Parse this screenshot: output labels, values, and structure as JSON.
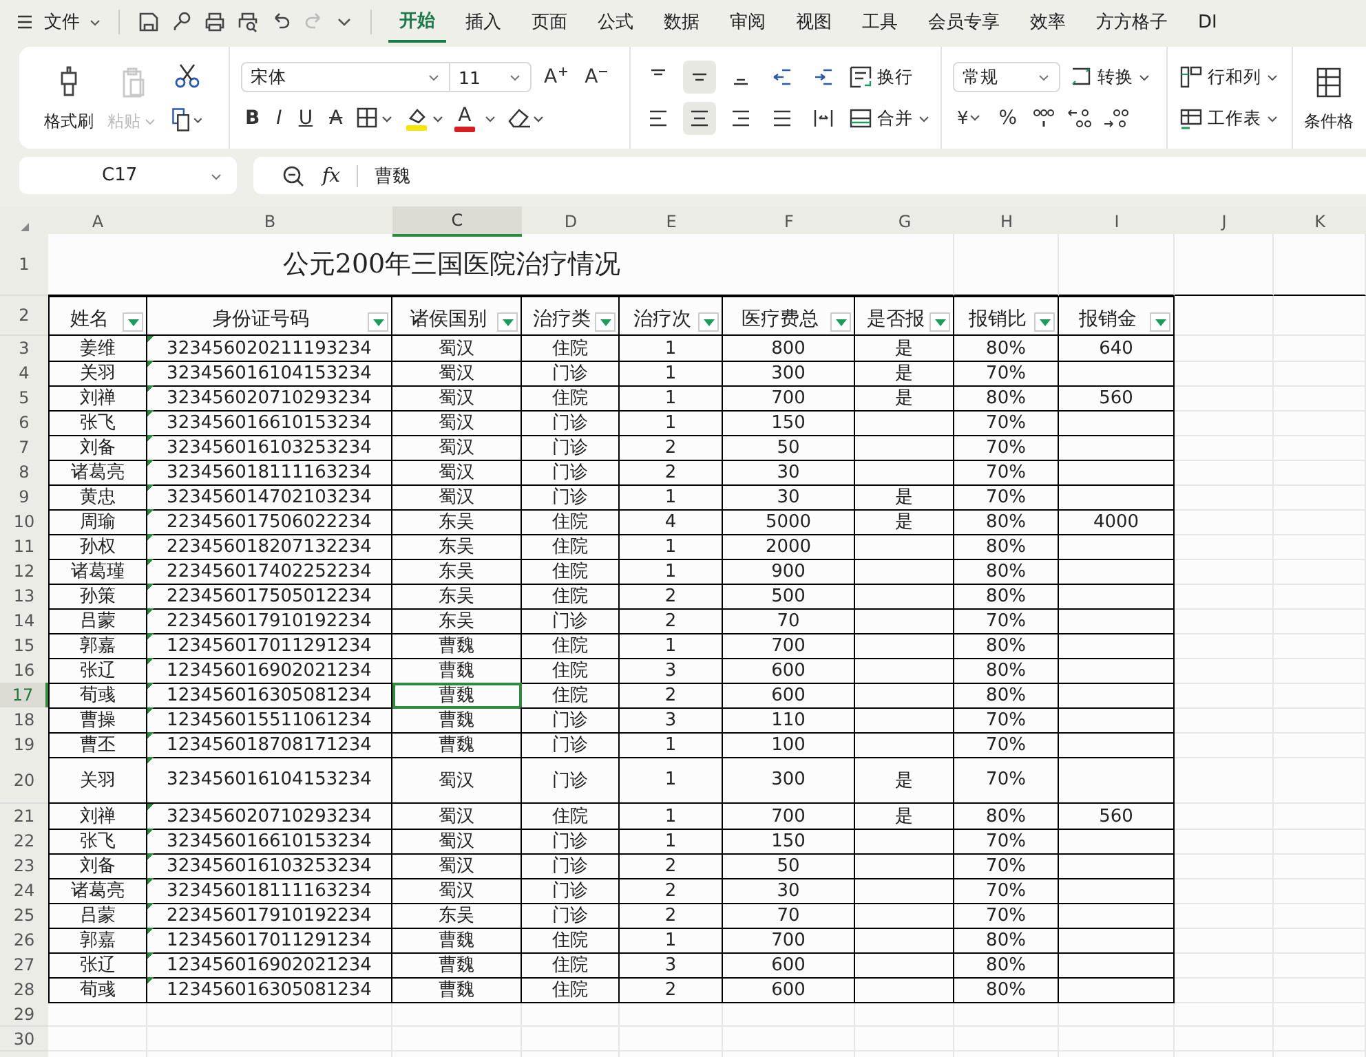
{
  "menu_bar": {
    "file_label": "文件",
    "tabs": [
      {
        "label": "开始",
        "selected": true
      },
      {
        "label": "插入",
        "selected": false
      },
      {
        "label": "页面",
        "selected": false
      },
      {
        "label": "公式",
        "selected": false
      },
      {
        "label": "数据",
        "selected": false
      },
      {
        "label": "审阅",
        "selected": false
      },
      {
        "label": "视图",
        "selected": false
      },
      {
        "label": "工具",
        "selected": false
      },
      {
        "label": "会员专享",
        "selected": false
      },
      {
        "label": "效率",
        "selected": false
      },
      {
        "label": "方方格子",
        "selected": false
      },
      {
        "label": "DI",
        "selected": false
      }
    ]
  },
  "ribbon": {
    "format_painter": "格式刷",
    "paste": {
      "label": "粘贴",
      "disabled": true
    },
    "font": {
      "family": "宋体",
      "size": "11",
      "grow": "A",
      "shrink": "A",
      "styles": [
        {
          "label": "B",
          "kind": "bold"
        },
        {
          "label": "I",
          "kind": "italic"
        },
        {
          "label": "U",
          "kind": "underline"
        },
        {
          "label": "A",
          "kind": "strike"
        }
      ],
      "font_color": "A"
    },
    "alignment": {
      "row_1": [
        {
          "kind": "top",
          "selected": false
        },
        {
          "kind": "middle",
          "selected": true
        },
        {
          "kind": "bottom",
          "selected": false
        },
        {
          "kind": "outdent",
          "selected": false
        },
        {
          "kind": "indent",
          "selected": false
        }
      ],
      "wrap": "换行",
      "row_2": [
        {
          "kind": "left",
          "selected": false
        },
        {
          "kind": "center",
          "selected": true
        },
        {
          "kind": "right",
          "selected": false
        },
        {
          "kind": "justify",
          "selected": false
        },
        {
          "kind": "distributed",
          "selected": false
        }
      ],
      "merge": "合并"
    },
    "number": {
      "format": "常规",
      "convert": "转换",
      "currency": "¥",
      "percent": "%"
    },
    "cells": {
      "rows_cols": "行和列",
      "worksheet": "工作表"
    },
    "conditional": "条件格"
  },
  "formula_bar": {
    "name_box": "C17",
    "fx": "fx",
    "value": "曹魏"
  },
  "sheet": {
    "columns": [
      {
        "letter": "A",
        "selected": false
      },
      {
        "letter": "B",
        "selected": false
      },
      {
        "letter": "C",
        "selected": true
      },
      {
        "letter": "D",
        "selected": false
      },
      {
        "letter": "E",
        "selected": false
      },
      {
        "letter": "F",
        "selected": false
      },
      {
        "letter": "G",
        "selected": false
      },
      {
        "letter": "H",
        "selected": false
      },
      {
        "letter": "I",
        "selected": false
      },
      {
        "letter": "J",
        "selected": false
      },
      {
        "letter": "K",
        "selected": false
      }
    ],
    "title_row": "1",
    "title": "公元200年三国医院治疗情况",
    "header_row": "2",
    "headers": [
      "姓名",
      "身份证号码",
      "诸侯国别",
      "治疗类",
      "治疗次",
      "医疗费总",
      "是否报",
      "报销比",
      "报销金"
    ],
    "rows": [
      {
        "num": "3",
        "kind": "normal",
        "selected": false,
        "name": "姜维",
        "id": "323456020211193234",
        "state": "蜀汉",
        "type": "住院",
        "visits": "1",
        "total": "800",
        "reimbursed": "是",
        "ratio": "80%",
        "amount": "640"
      },
      {
        "num": "4",
        "kind": "normal",
        "selected": false,
        "name": "关羽",
        "id": "323456016104153234",
        "state": "蜀汉",
        "type": "门诊",
        "visits": "1",
        "total": "300",
        "reimbursed": "是",
        "ratio": "70%"
      },
      {
        "num": "5",
        "kind": "normal",
        "selected": false,
        "name": "刘禅",
        "id": "323456020710293234",
        "state": "蜀汉",
        "type": "住院",
        "visits": "1",
        "total": "700",
        "reimbursed": "是",
        "ratio": "80%",
        "amount": "560"
      },
      {
        "num": "6",
        "kind": "normal",
        "selected": false,
        "name": "张飞",
        "id": "323456016610153234",
        "state": "蜀汉",
        "type": "门诊",
        "visits": "1",
        "total": "150",
        "ratio": "70%"
      },
      {
        "num": "7",
        "kind": "normal",
        "selected": false,
        "name": "刘备",
        "id": "323456016103253234",
        "state": "蜀汉",
        "type": "门诊",
        "visits": "2",
        "total": "50",
        "ratio": "70%"
      },
      {
        "num": "8",
        "kind": "normal",
        "selected": false,
        "name": "诸葛亮",
        "id": "323456018111163234",
        "state": "蜀汉",
        "type": "门诊",
        "visits": "2",
        "total": "30",
        "ratio": "70%"
      },
      {
        "num": "9",
        "kind": "normal",
        "selected": false,
        "name": "黄忠",
        "id": "323456014702103234",
        "state": "蜀汉",
        "type": "门诊",
        "visits": "1",
        "total": "30",
        "reimbursed": "是",
        "ratio": "70%"
      },
      {
        "num": "10",
        "kind": "normal",
        "selected": false,
        "name": "周瑜",
        "id": "223456017506022234",
        "state": "东吴",
        "type": "住院",
        "visits": "4",
        "total": "5000",
        "reimbursed": "是",
        "ratio": "80%",
        "amount": "4000"
      },
      {
        "num": "11",
        "kind": "normal",
        "selected": false,
        "name": "孙权",
        "id": "223456018207132234",
        "state": "东吴",
        "type": "住院",
        "visits": "1",
        "total": "2000",
        "ratio": "80%"
      },
      {
        "num": "12",
        "kind": "normal",
        "selected": false,
        "name": "诸葛瑾",
        "id": "223456017402252234",
        "state": "东吴",
        "type": "住院",
        "visits": "1",
        "total": "900",
        "ratio": "80%"
      },
      {
        "num": "13",
        "kind": "normal",
        "selected": false,
        "name": "孙策",
        "id": "223456017505012234",
        "state": "东吴",
        "type": "住院",
        "visits": "2",
        "total": "500",
        "ratio": "80%"
      },
      {
        "num": "14",
        "kind": "normal",
        "selected": false,
        "name": "吕蒙",
        "id": "223456017910192234",
        "state": "东吴",
        "type": "门诊",
        "visits": "2",
        "total": "70",
        "ratio": "70%"
      },
      {
        "num": "15",
        "kind": "normal",
        "selected": false,
        "name": "郭嘉",
        "id": "123456017011291234",
        "state": "曹魏",
        "type": "住院",
        "visits": "1",
        "total": "700",
        "ratio": "80%"
      },
      {
        "num": "16",
        "kind": "normal",
        "selected": false,
        "name": "张辽",
        "id": "123456016902021234",
        "state": "曹魏",
        "type": "住院",
        "visits": "3",
        "total": "600",
        "ratio": "80%"
      },
      {
        "num": "17",
        "kind": "normal",
        "selected": true,
        "name": "荀彧",
        "id": "123456016305081234",
        "state": "曹魏",
        "type": "住院",
        "visits": "2",
        "total": "600",
        "ratio": "80%"
      },
      {
        "num": "18",
        "kind": "normal",
        "selected": false,
        "name": "曹操",
        "id": "123456015511061234",
        "state": "曹魏",
        "type": "门诊",
        "visits": "3",
        "total": "110",
        "ratio": "70%"
      },
      {
        "num": "19",
        "kind": "normal",
        "selected": false,
        "name": "曹丕",
        "id": "123456018708171234",
        "state": "曹魏",
        "type": "门诊",
        "visits": "1",
        "total": "100",
        "ratio": "70%"
      },
      {
        "num": "20",
        "kind": "tall",
        "selected": false,
        "name": "关羽",
        "id": "323456016104153234",
        "state": "蜀汉",
        "type": "门诊",
        "visits": "1",
        "total": "300",
        "reimbursed": "是",
        "ratio": "70%"
      },
      {
        "num": "21",
        "kind": "normal",
        "selected": false,
        "name": "刘禅",
        "id": "323456020710293234",
        "state": "蜀汉",
        "type": "住院",
        "visits": "1",
        "total": "700",
        "reimbursed": "是",
        "ratio": "80%",
        "amount": "560"
      },
      {
        "num": "22",
        "kind": "normal",
        "selected": false,
        "name": "张飞",
        "id": "323456016610153234",
        "state": "蜀汉",
        "type": "门诊",
        "visits": "1",
        "total": "150",
        "ratio": "70%"
      },
      {
        "num": "23",
        "kind": "normal",
        "selected": false,
        "name": "刘备",
        "id": "323456016103253234",
        "state": "蜀汉",
        "type": "门诊",
        "visits": "2",
        "total": "50",
        "ratio": "70%"
      },
      {
        "num": "24",
        "kind": "normal",
        "selected": false,
        "name": "诸葛亮",
        "id": "323456018111163234",
        "state": "蜀汉",
        "type": "门诊",
        "visits": "2",
        "total": "30",
        "ratio": "70%"
      },
      {
        "num": "25",
        "kind": "normal",
        "selected": false,
        "name": "吕蒙",
        "id": "223456017910192234",
        "state": "东吴",
        "type": "门诊",
        "visits": "2",
        "total": "70",
        "ratio": "70%"
      },
      {
        "num": "26",
        "kind": "normal",
        "selected": false,
        "name": "郭嘉",
        "id": "123456017011291234",
        "state": "曹魏",
        "type": "住院",
        "visits": "1",
        "total": "700",
        "ratio": "80%"
      },
      {
        "num": "27",
        "kind": "normal",
        "selected": false,
        "name": "张辽",
        "id": "123456016902021234",
        "state": "曹魏",
        "type": "住院",
        "visits": "3",
        "total": "600",
        "ratio": "80%"
      },
      {
        "num": "28",
        "kind": "normal",
        "selected": false,
        "name": "荀彧",
        "id": "123456016305081234",
        "state": "曹魏",
        "type": "住院",
        "visits": "2",
        "total": "600",
        "ratio": "80%"
      }
    ],
    "empty_rows": [
      "29",
      "30"
    ]
  }
}
